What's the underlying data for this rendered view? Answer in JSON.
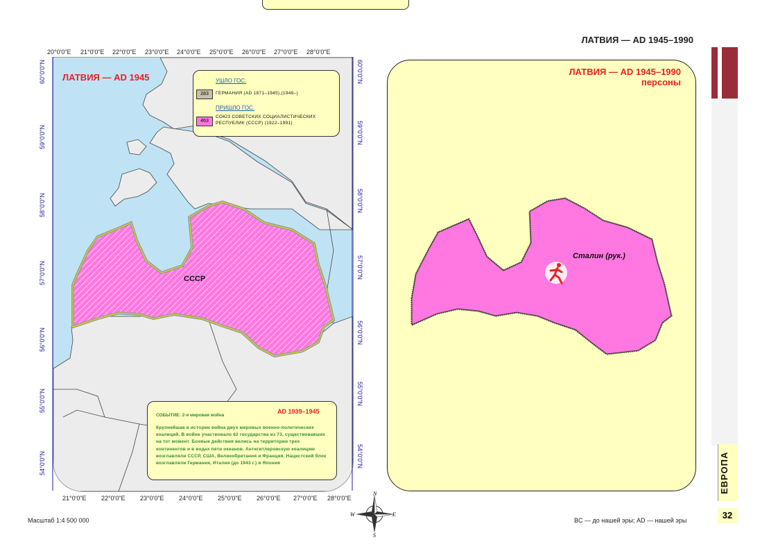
{
  "header": {
    "page_title": "ЛАТВИЯ — AD 1945–1990"
  },
  "left_map": {
    "title": "ЛАТВИЯ — AD 1945",
    "top_lon": [
      "20°0'0\"E",
      "21°0'0\"E",
      "22°0'0\"E",
      "23°0'0\"E",
      "24°0'0\"E",
      "25°0'0\"E",
      "26°0'0\"E",
      "27°0'0\"E",
      "28°0'0\"E"
    ],
    "bottom_lon": [
      "21°0'0\"E",
      "22°0'0\"E",
      "23°0'0\"E",
      "24°0'0\"E",
      "25°0'0\"E",
      "26°0'0\"E",
      "27°0'0\"E",
      "28°0'0\"E"
    ],
    "lat": [
      "60°0'0\"N",
      "59°0'0\"N",
      "58°0'0\"N",
      "57°0'0\"N",
      "56°0'0\"N",
      "55°0'0\"N",
      "54°0'0\"N"
    ],
    "region_label": "СССР",
    "legend": {
      "left_heading": "УШЛО ГОС.",
      "left_item": {
        "code": "283",
        "text": "ГЕРМАНИЯ  (AD 1871–1945),(1949–)",
        "color": "#c8c0a8"
      },
      "came_heading": "ПРИШЛО ГОС.",
      "came_item": {
        "code": "463",
        "text": "СОЮЗ СОВЕТСКИХ СОЦИАЛИСТИЧЕСКИХ РЕСПУБЛИК (СССР) (1922–1991)",
        "color": "#ff77e0"
      }
    },
    "event": {
      "dates": "AD 1939–1945",
      "title": "СОБЫТИЕ: 2-я мировая война",
      "text": "Крупнейшая в истории война двух мировых военно-политических коалиций. В войне участвовало 62 государства из 73, существовавших на тот момент. Боевые действия велись на территории трех континентов и в водах пяти океанов. Антигитлеровскую коалицию возглавляли СССР, США, Великобритания и Франция. Нацистский блок возглавляли Германия, Италия (до 1943 г.) и Япония"
    }
  },
  "right_map": {
    "title_line1": "ЛАТВИЯ — AD 1945–1990",
    "title_line2": "персоны",
    "person_label": "Сталин (рук.)",
    "person_icon": "running-person-icon"
  },
  "compass": {
    "n": "N",
    "e": "E",
    "s": "S",
    "w": "W"
  },
  "footer": {
    "scale": "Масштаб 1:4 500 000",
    "legend_note": "BC — до нашей эры; AD — нашей эры",
    "section_tab": "ЕВРОПА",
    "page_number": "32"
  },
  "colors": {
    "accent_red": "#e8211e",
    "card_bg": "#ffffc0",
    "latvia_pink": "#ff77e0",
    "sea": "#bfe3f5",
    "land": "#ececec",
    "tab_bar": "#9b2c3a"
  }
}
